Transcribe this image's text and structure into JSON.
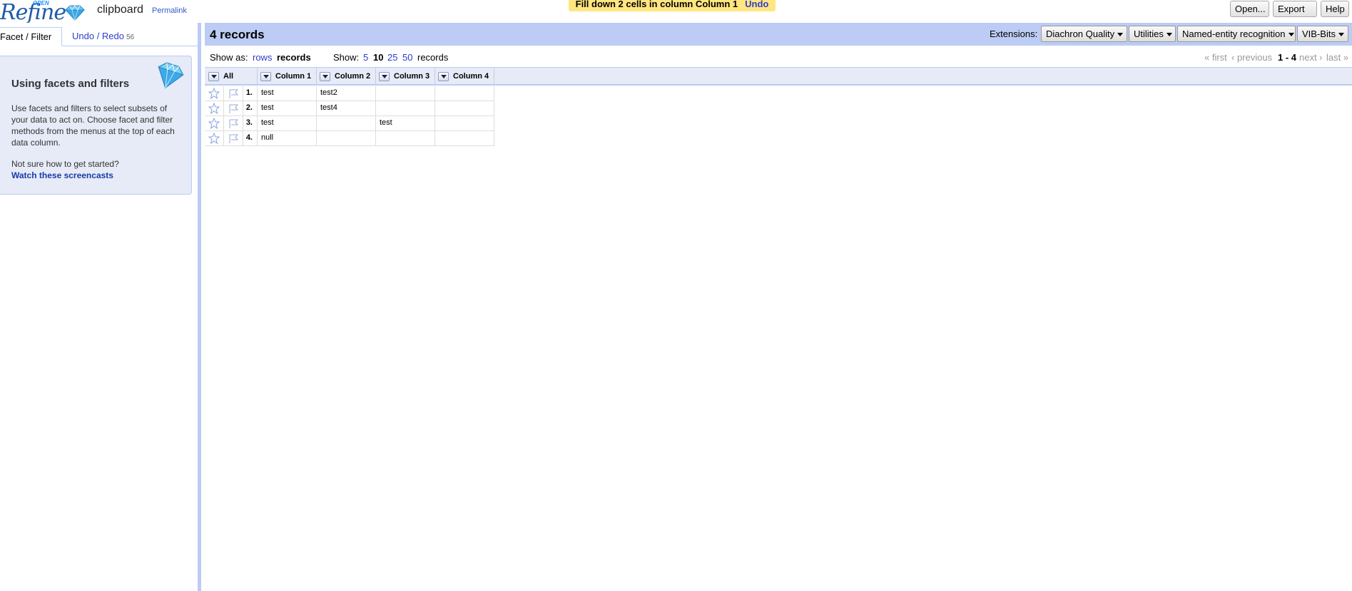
{
  "app": {
    "logo_text": "Refine",
    "logo_open": "OPEN",
    "project_name": "clipboard",
    "permalink": "Permalink"
  },
  "notification": {
    "message": "Fill down 2 cells in column Column 1",
    "undo": "Undo"
  },
  "header_buttons": {
    "open": "Open...",
    "export": "Export",
    "help": "Help"
  },
  "left_tabs": {
    "facet": "Facet / Filter",
    "undo_redo": "Undo / Redo",
    "undo_count": "56"
  },
  "help_box": {
    "title": "Using facets and filters",
    "body": "Use facets and filters to select subsets of your data to act on. Choose facet and filter methods from the menus at the top of each data column.",
    "question": "Not sure how to get started?",
    "link": "Watch these screencasts"
  },
  "summary": {
    "record_count": "4 records",
    "extensions_label": "Extensions:",
    "extensions": [
      "Diachron Quality",
      "Utilities",
      "Named-entity recognition",
      "VIB-Bits"
    ]
  },
  "view_bar": {
    "show_as_label": "Show as:",
    "rows": "rows",
    "records": "records",
    "show_label": "Show:",
    "page_sizes": [
      "5",
      "10",
      "25",
      "50"
    ],
    "page_size_suffix": "records",
    "first": "« first",
    "previous": "‹ previous",
    "range": "1 - 4",
    "next": "next ›",
    "last": "last »"
  },
  "table": {
    "all_label": "All",
    "columns": [
      "Column 1",
      "Column 2",
      "Column 3",
      "Column 4"
    ],
    "rows": [
      {
        "index": "1.",
        "cells": [
          "test",
          "test2",
          "",
          ""
        ]
      },
      {
        "index": "2.",
        "cells": [
          "test",
          "test4",
          "",
          ""
        ]
      },
      {
        "index": "3.",
        "cells": [
          "test",
          "",
          "test",
          ""
        ]
      },
      {
        "index": "4.",
        "cells": [
          "null",
          "",
          "",
          ""
        ]
      }
    ]
  },
  "colors": {
    "accent": "#bcccf4",
    "link": "#2e3cc8",
    "notification": "#ffe680"
  }
}
